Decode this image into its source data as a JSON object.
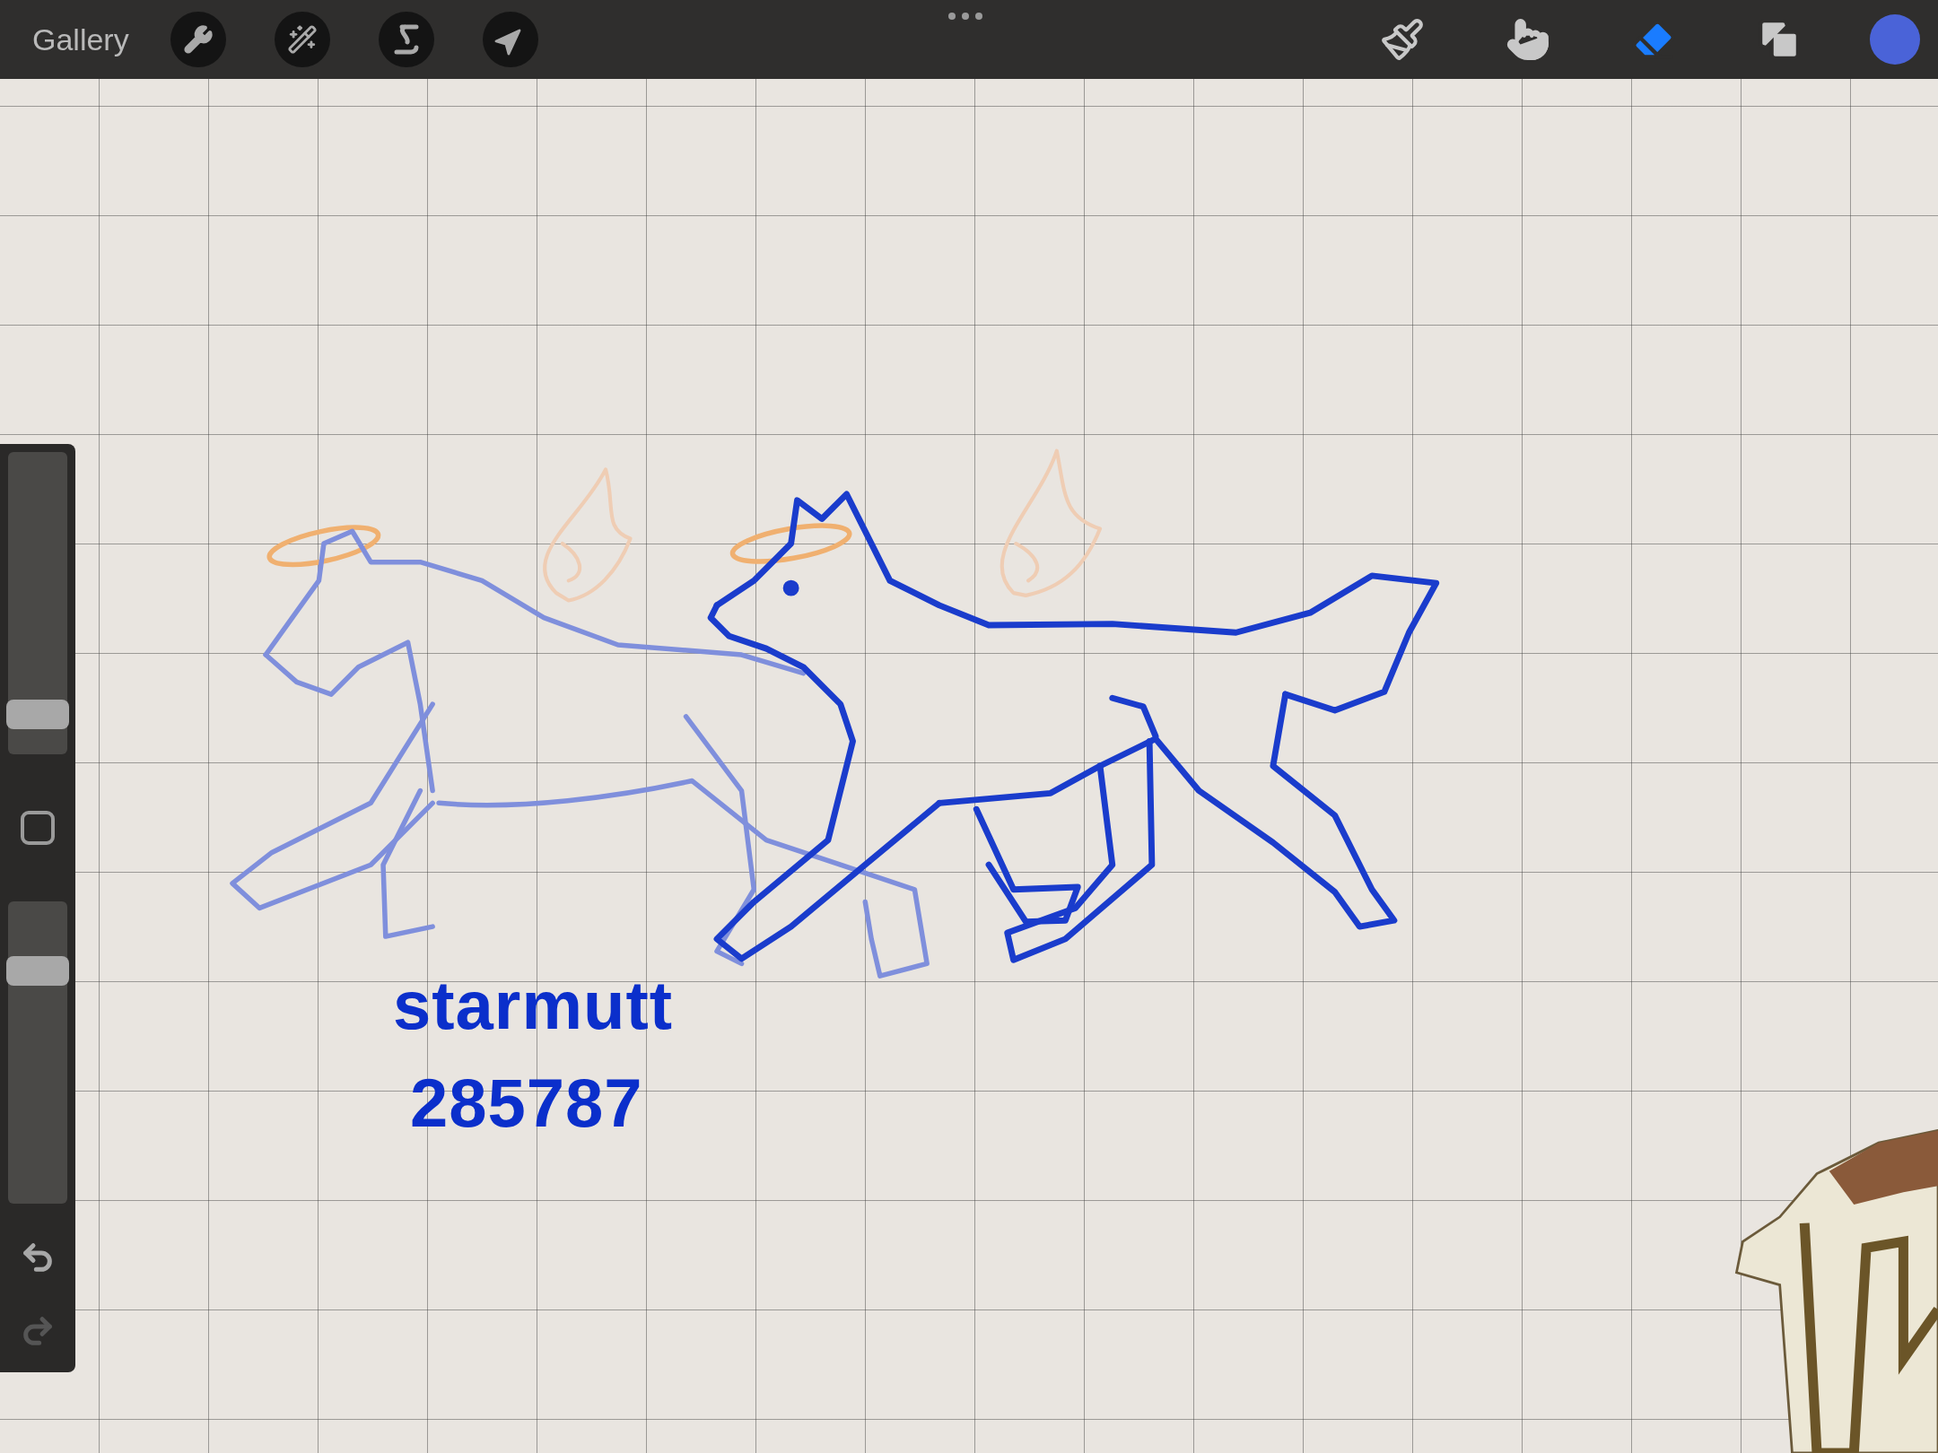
{
  "toolbar": {
    "gallery": "Gallery",
    "left_tools": [
      {
        "kind": "wrench"
      },
      {
        "kind": "wand"
      },
      {
        "kind": "selection"
      },
      {
        "kind": "transform"
      }
    ],
    "right_tools": [
      {
        "kind": "brush",
        "selected": false
      },
      {
        "kind": "smudge",
        "selected": false
      },
      {
        "kind": "eraser",
        "selected": true
      },
      {
        "kind": "layers",
        "selected": false
      }
    ],
    "color_swatch": {
      "color": "#4a63d8"
    }
  },
  "sidebar": {
    "brush_size": {
      "level": 0.13
    },
    "opacity": {
      "level": 0.77
    },
    "undo": {
      "disabled": false
    },
    "redo": {
      "disabled": true
    }
  },
  "canvas": {
    "texts": [
      "starmutt",
      "285787"
    ]
  }
}
